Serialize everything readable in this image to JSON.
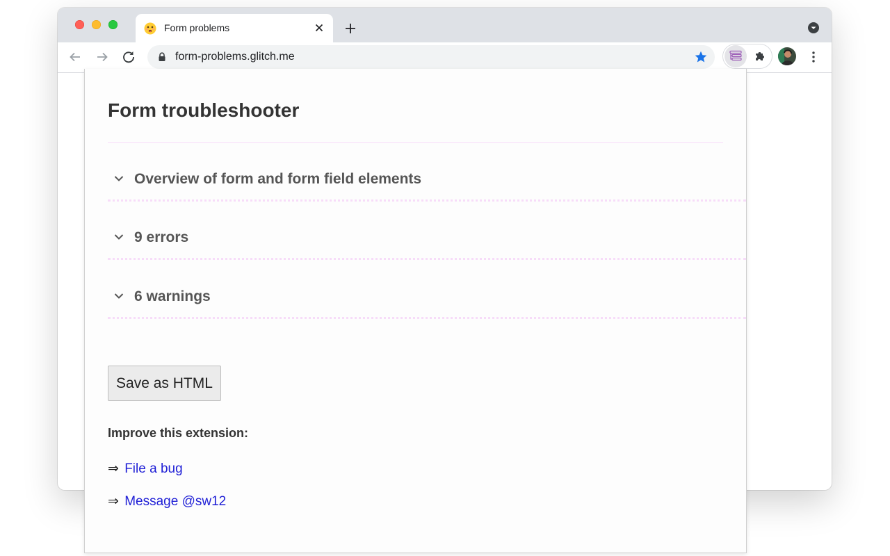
{
  "browser": {
    "tab": {
      "title": "Form problems",
      "favicon": "flushed-face-emoji-icon"
    },
    "address_bar": {
      "url": "form-problems.glitch.me"
    },
    "icons": {
      "back": "back-arrow-icon",
      "forward": "forward-arrow-icon",
      "reload": "reload-icon",
      "lock": "lock-icon",
      "bookmark": "star-icon",
      "extension": "form-troubleshooter-extension-icon",
      "extensions_menu": "puzzle-icon",
      "profile": "avatar",
      "menu": "kebab-menu-icon"
    },
    "colors": {
      "tabstrip": "#dee1e6",
      "star": "#1a73e8"
    }
  },
  "popup": {
    "title": "Form troubleshooter",
    "sections": [
      {
        "label": "Overview of form and form field elements"
      },
      {
        "label": "9 errors"
      },
      {
        "label": "6 warnings"
      }
    ],
    "save_button": "Save as HTML",
    "improve_heading": "Improve this extension:",
    "links": [
      {
        "arrow": "⇒",
        "text": "File a bug"
      },
      {
        "arrow": "⇒",
        "text": "Message @sw12"
      }
    ],
    "colors": {
      "divider": "#f7dcf9",
      "link": "#1f1fd6",
      "heading": "#333333"
    }
  }
}
